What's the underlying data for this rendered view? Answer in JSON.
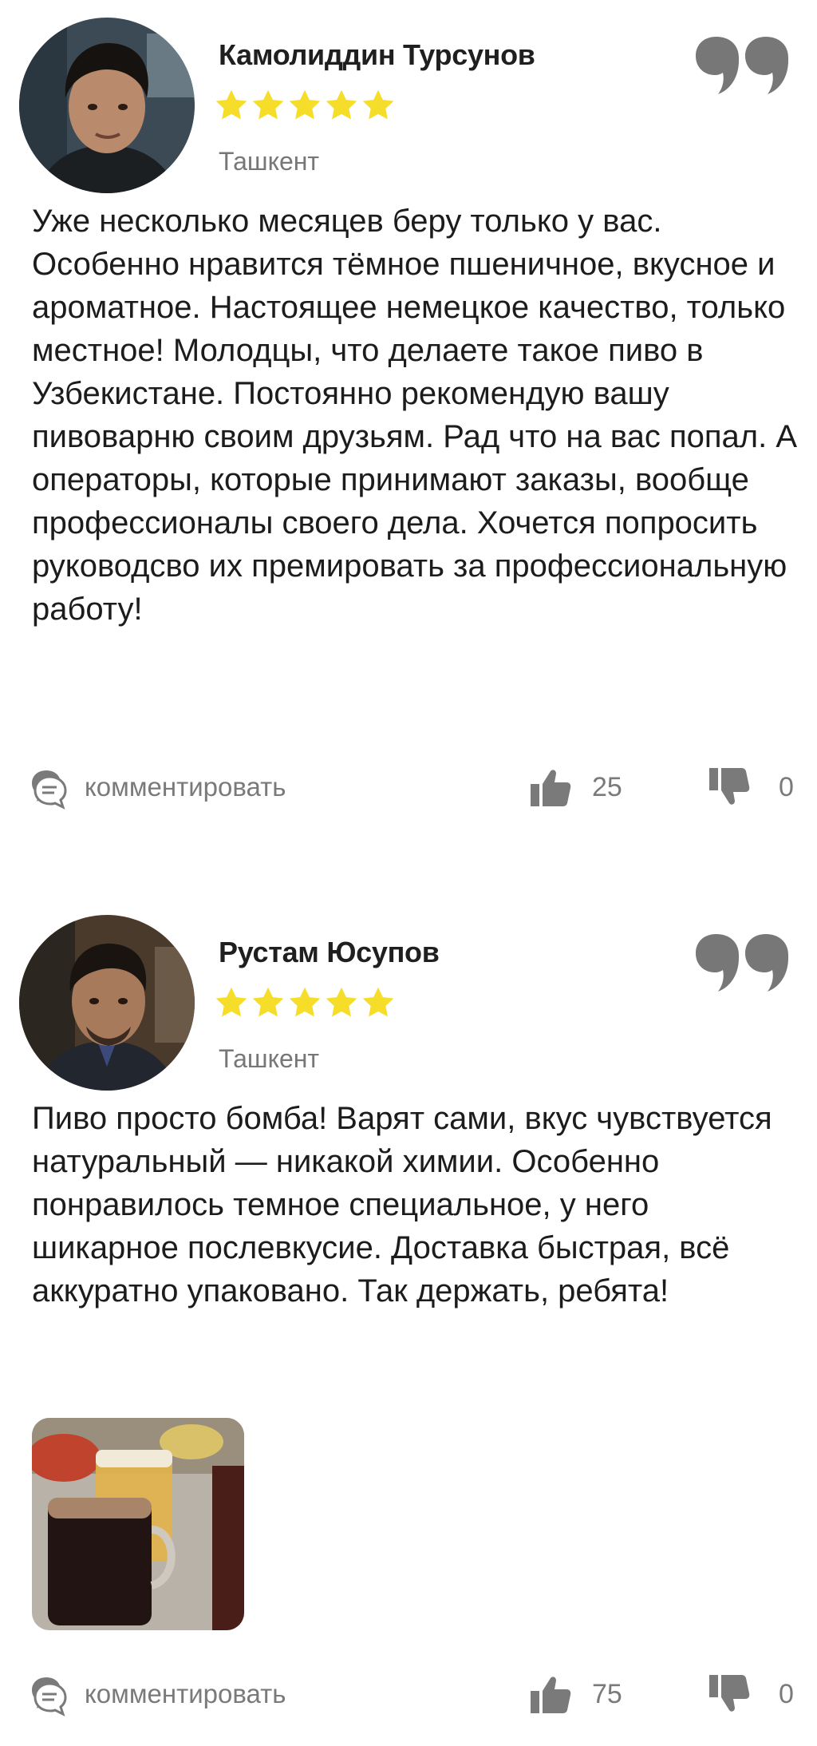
{
  "reviews": [
    {
      "name": "Камолиддин Турсунов",
      "rating": 5,
      "city": "Ташкент",
      "text": "Уже несколько месяцев беру только у вас. Особенно нравится тёмное пшеничное, вкусное и ароматное. Настоящее немецкое качество, только местное! Молодцы, что делаете такое пиво в Узбекистане. Постоянно рекомендую вашу пивоварню своим друзьям. Рад что на вас попал. А операторы, которые принимают заказы, вообще профессионалы своего дела. Хочется попросить руководсво их премировать за профессиональную работу!",
      "comment_label": "комментировать",
      "likes": "25",
      "dislikes": "0"
    },
    {
      "name": "Рустам Юсупов",
      "rating": 5,
      "city": "Ташкент",
      "text": "Пиво просто бомба! Варят сами, вкус чувствуется натуральный — никакой химии. Особенно понравилось темное специальное, у него шикарное послевкусие. Доставка быстрая, всё аккуратно упаковано. Так держать, ребята!",
      "comment_label": "комментировать",
      "likes": "75",
      "dislikes": "0"
    }
  ],
  "colors": {
    "star": "#f5dd2a",
    "icon_gray": "#7a7a7a",
    "text": "#1c1c1c",
    "muted": "#777777"
  },
  "icons": {
    "quote": "quote-icon",
    "star": "star-icon",
    "comment": "comment-icon",
    "like": "thumbs-up-icon",
    "dislike": "thumbs-down-icon"
  }
}
